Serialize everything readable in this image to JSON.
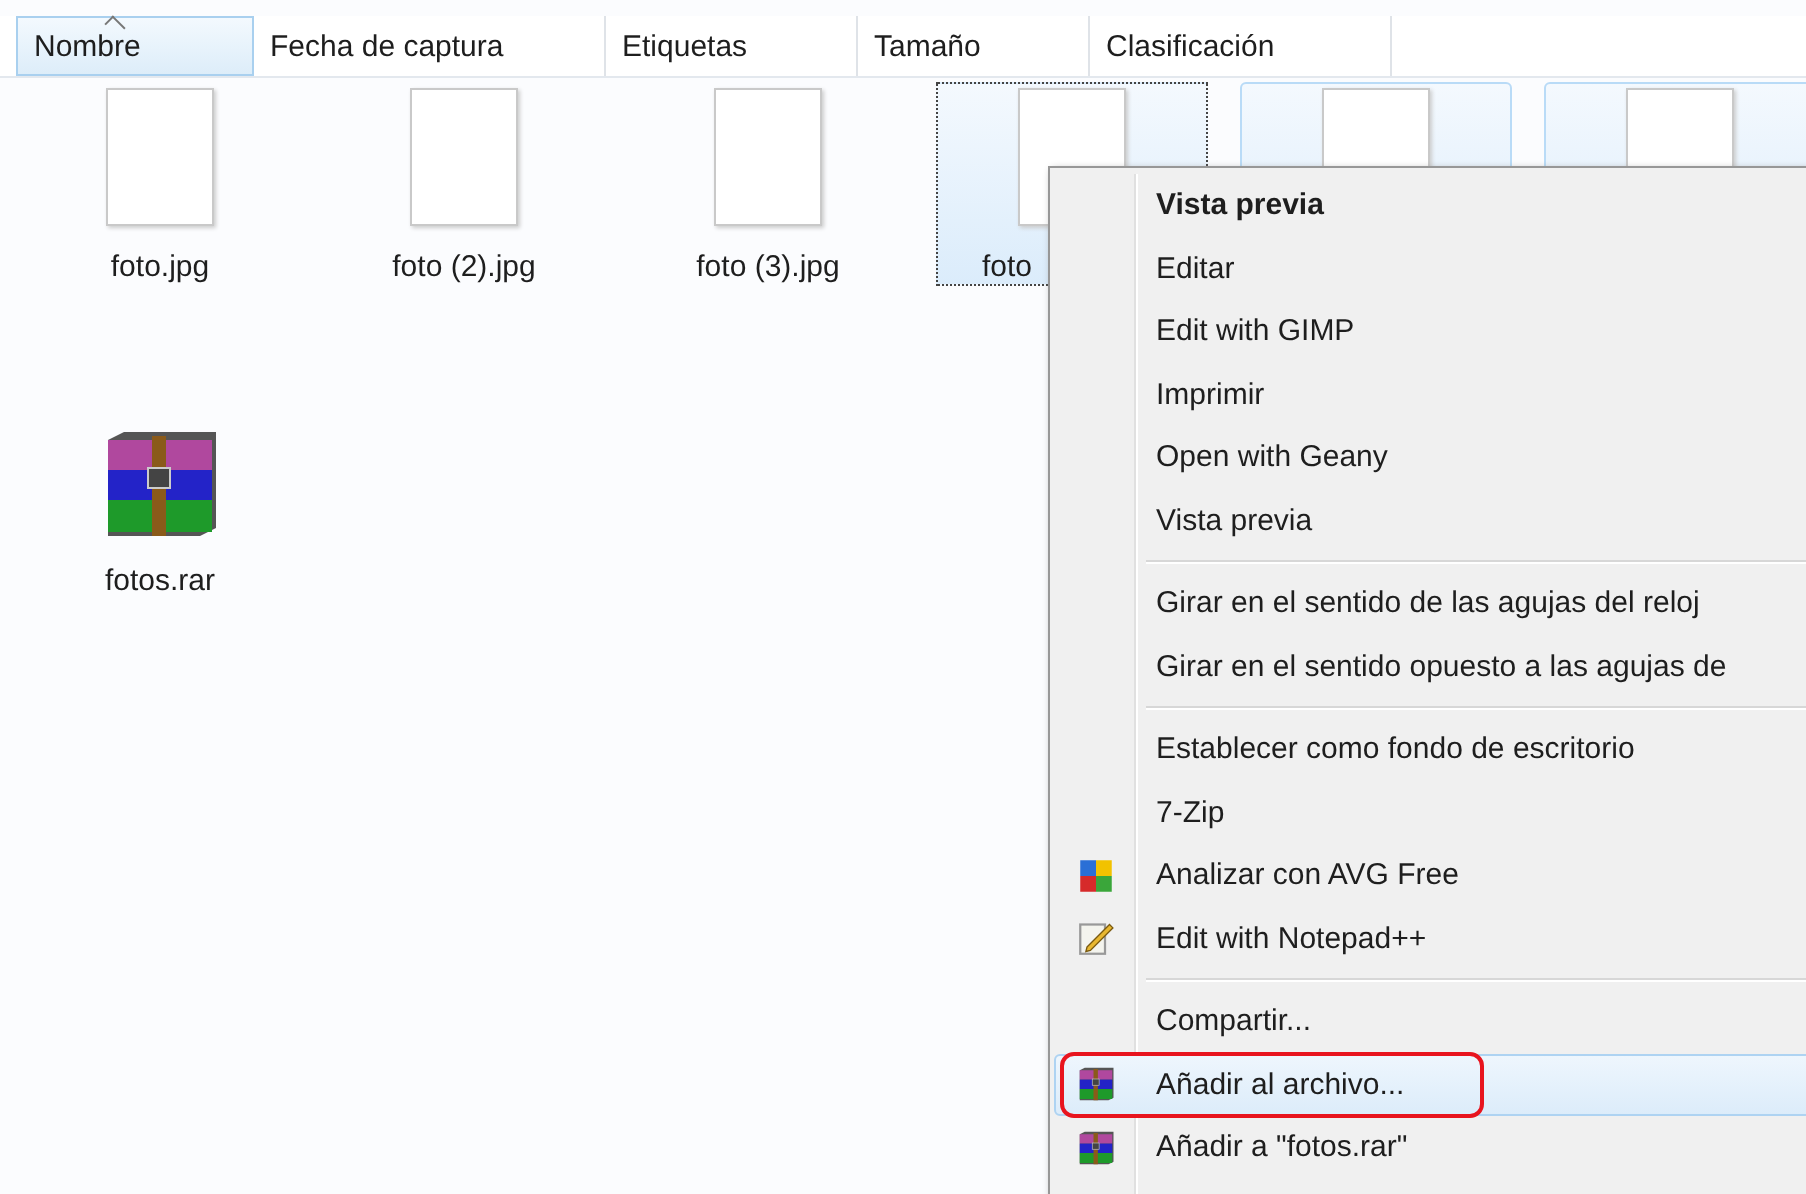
{
  "columns": [
    {
      "label": "Nombre",
      "sorted": true
    },
    {
      "label": "Fecha de captura",
      "sorted": false
    },
    {
      "label": "Etiquetas",
      "sorted": false
    },
    {
      "label": "Tamaño",
      "sorted": false
    },
    {
      "label": "Clasificación",
      "sorted": false
    }
  ],
  "files": [
    {
      "name": "foto.jpg",
      "kind": "image",
      "selected": false,
      "focused": false
    },
    {
      "name": "foto (2).jpg",
      "kind": "image",
      "selected": false,
      "focused": false
    },
    {
      "name": "foto (3).jpg",
      "kind": "image",
      "selected": false,
      "focused": false
    },
    {
      "name": "foto",
      "kind": "image",
      "selected": true,
      "focused": true
    },
    {
      "kind": "image",
      "selected": true,
      "focused": false
    },
    {
      "kind": "image",
      "selected": true,
      "focused": false
    },
    {
      "name": "fotos.rar",
      "kind": "archive",
      "selected": false,
      "focused": false
    }
  ],
  "context_menu": [
    {
      "kind": "plain",
      "label": "Vista previa",
      "bold": true,
      "selected": false
    },
    {
      "kind": "plain",
      "label": "Editar",
      "bold": false,
      "selected": false
    },
    {
      "kind": "plain",
      "label": "Edit with GIMP",
      "bold": false,
      "selected": false
    },
    {
      "kind": "plain",
      "label": "Imprimir",
      "bold": false,
      "selected": false
    },
    {
      "kind": "plain",
      "label": "Open with Geany",
      "bold": false,
      "selected": false
    },
    {
      "kind": "plain",
      "label": "Vista previa",
      "bold": false,
      "selected": false
    },
    {
      "kind": "separator"
    },
    {
      "kind": "plain",
      "label": "Girar en el sentido de las agujas del reloj",
      "bold": false,
      "selected": false
    },
    {
      "kind": "plain",
      "label": "Girar en el sentido opuesto a las agujas de",
      "bold": false,
      "selected": false
    },
    {
      "kind": "separator"
    },
    {
      "kind": "plain",
      "label": "Establecer como fondo de escritorio",
      "bold": false,
      "selected": false
    },
    {
      "kind": "plain",
      "label": "7-Zip",
      "bold": false,
      "selected": false
    },
    {
      "kind": "scan",
      "label": "Analizar con AVG Free",
      "bold": false,
      "selected": false
    },
    {
      "kind": "notepad",
      "label": "Edit with Notepad++",
      "bold": false,
      "selected": false
    },
    {
      "kind": "separator"
    },
    {
      "kind": "plain",
      "label": "Compartir...",
      "bold": false,
      "selected": false
    },
    {
      "kind": "archive",
      "label": "Añadir al archivo...",
      "bold": false,
      "selected": true,
      "circled": true
    },
    {
      "kind": "archive",
      "label": "Añadir a \"fotos.rar\"",
      "bold": false,
      "selected": false,
      "circled": false
    }
  ]
}
